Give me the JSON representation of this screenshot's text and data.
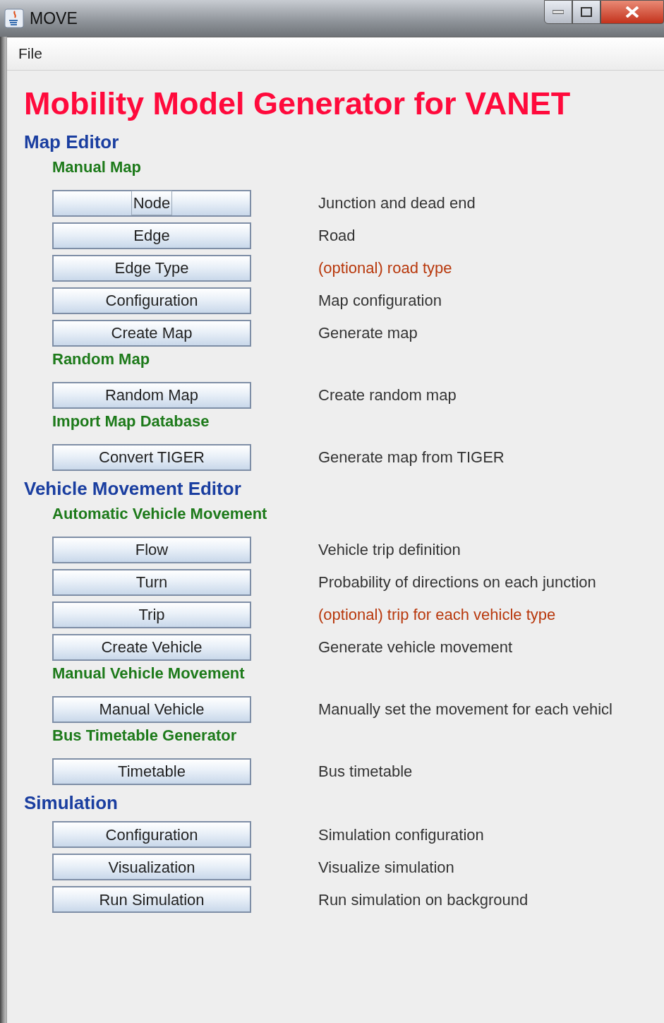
{
  "window": {
    "title": "MOVE"
  },
  "menu": [
    {
      "label": "File"
    }
  ],
  "heading": "Mobility Model Generator for VANET",
  "sections": [
    {
      "title": "Map Editor",
      "groups": [
        {
          "title": "Manual Map",
          "actions": [
            {
              "label": "Node",
              "focused": true,
              "description": "Junction and dead end",
              "optional": false
            },
            {
              "label": "Edge",
              "focused": false,
              "description": "Road",
              "optional": false
            },
            {
              "label": "Edge Type",
              "focused": false,
              "description": "(optional) road type",
              "optional": true
            },
            {
              "label": "Configuration",
              "focused": false,
              "description": "Map configuration",
              "optional": false
            },
            {
              "label": "Create Map",
              "focused": false,
              "description": "Generate map",
              "optional": false
            }
          ]
        },
        {
          "title": "Random Map",
          "actions": [
            {
              "label": "Random Map",
              "focused": false,
              "description": "Create random map",
              "optional": false
            }
          ]
        },
        {
          "title": "Import  Map Database",
          "actions": [
            {
              "label": "Convert TIGER",
              "focused": false,
              "description": "Generate map from TIGER",
              "optional": false
            }
          ]
        }
      ]
    },
    {
      "title": "Vehicle Movement Editor",
      "groups": [
        {
          "title": "Automatic Vehicle Movement",
          "actions": [
            {
              "label": "Flow",
              "focused": false,
              "description": "Vehicle trip definition",
              "optional": false
            },
            {
              "label": "Turn",
              "focused": false,
              "description": "Probability of directions on each junction",
              "optional": false
            },
            {
              "label": "Trip",
              "focused": false,
              "description": "(optional) trip for each vehicle type",
              "optional": true
            },
            {
              "label": "Create Vehicle",
              "focused": false,
              "description": "Generate vehicle movement",
              "optional": false
            }
          ]
        },
        {
          "title": "Manual Vehicle Movement",
          "actions": [
            {
              "label": "Manual Vehicle",
              "focused": false,
              "description": "Manually set the movement for each vehicl",
              "optional": false
            }
          ]
        },
        {
          "title": "Bus Timetable Generator",
          "actions": [
            {
              "label": "Timetable",
              "focused": false,
              "description": "Bus timetable",
              "optional": false
            }
          ]
        }
      ]
    },
    {
      "title": "Simulation",
      "groups": [
        {
          "actions": [
            {
              "label": "Configuration",
              "focused": false,
              "description": "Simulation configuration",
              "optional": false
            },
            {
              "label": "Visualization",
              "focused": false,
              "description": "Visualize simulation",
              "optional": false
            },
            {
              "label": "Run Simulation",
              "focused": false,
              "description": "Run simulation on background",
              "optional": false
            }
          ]
        }
      ]
    }
  ]
}
